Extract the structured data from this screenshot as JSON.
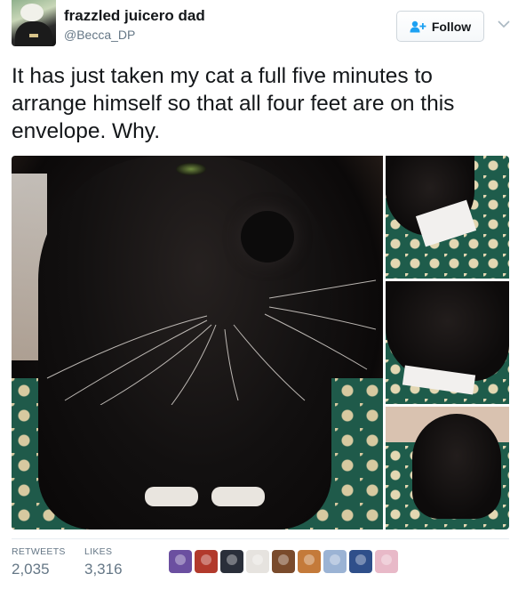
{
  "user": {
    "name": "frazzled juicero dad",
    "handle": "@Becca_DP"
  },
  "actions": {
    "follow_label": "Follow",
    "follow_icon": "add-user-icon",
    "more_icon": "chevron-down-icon"
  },
  "tweet": {
    "text": "It has just taken my cat a full five minutes to arrange himself so that all four feet are on this envelope. Why."
  },
  "media": {
    "photo_count": 4
  },
  "stats": {
    "retweets_label": "RETWEETS",
    "retweets_value": "2,035",
    "likes_label": "LIKES",
    "likes_value": "3,316"
  },
  "likers": {
    "count": 9,
    "avatar_colors": [
      "#6b4fa0",
      "#b23a2c",
      "#2a2f3a",
      "#e6e3df",
      "#7a4b2c",
      "#c47a3a",
      "#9bb3d4",
      "#2f4f8a",
      "#e8b9c8"
    ]
  },
  "colors": {
    "text": "#14171a",
    "secondary_text": "#657786",
    "border": "#e6ecf0",
    "accent": "#1da1f2"
  }
}
